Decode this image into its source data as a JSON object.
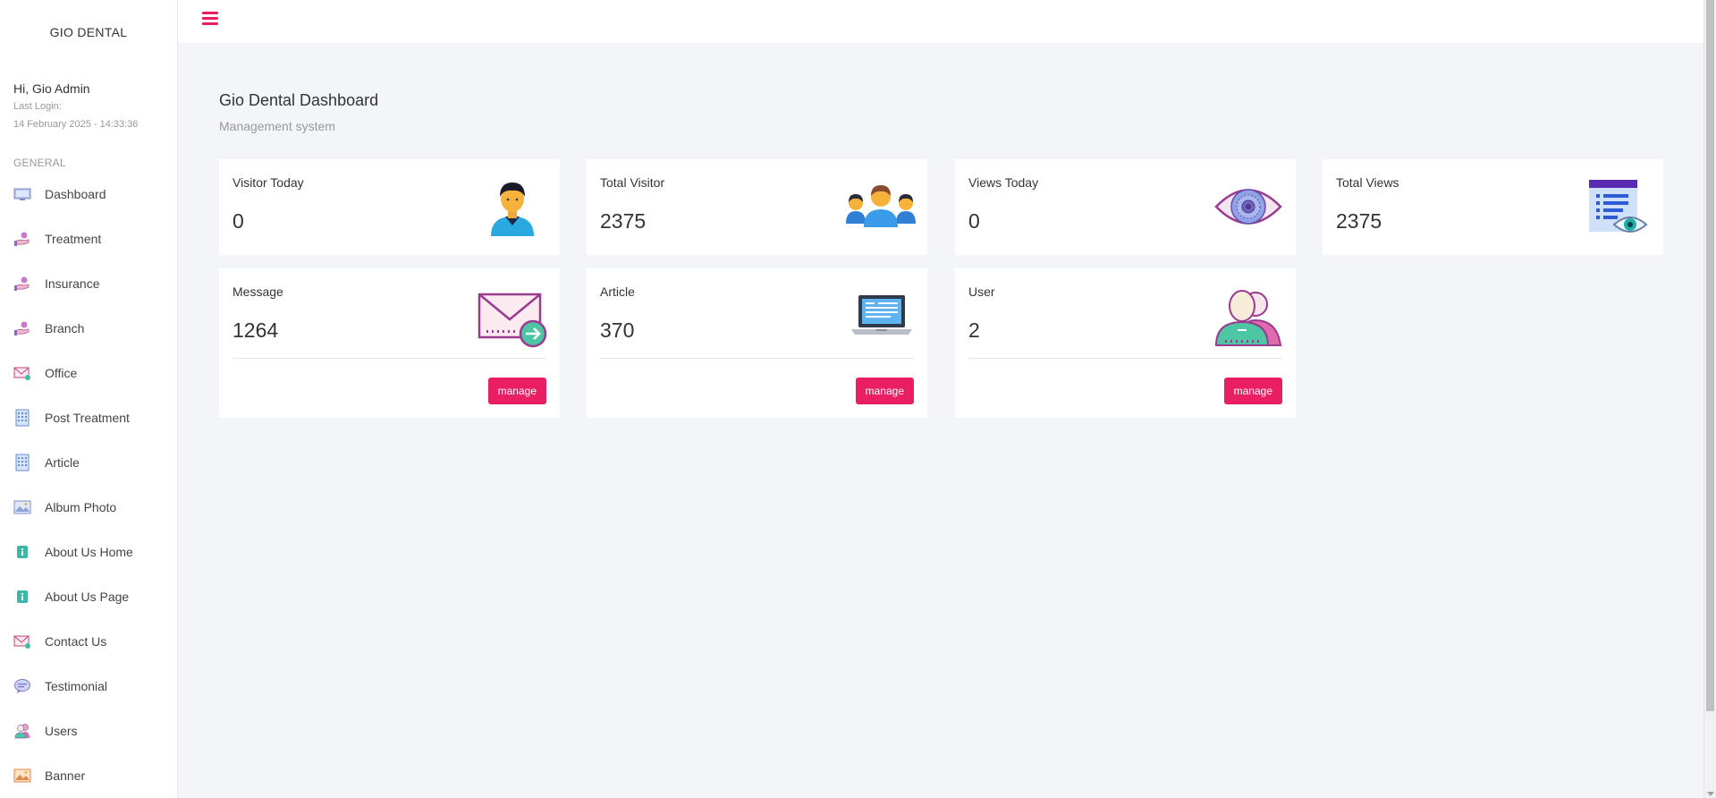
{
  "sidebar": {
    "brand": "GIO DENTAL",
    "greeting": "Hi, Gio Admin",
    "last_login_label": "Last Login:",
    "last_login_time": "14 February 2025 - 14:33:36",
    "section_title": "GENERAL",
    "items": [
      {
        "label": "Dashboard",
        "icon": "monitor-icon"
      },
      {
        "label": "Treatment",
        "icon": "hand-icon"
      },
      {
        "label": "Insurance",
        "icon": "hand-icon"
      },
      {
        "label": "Branch",
        "icon": "hand-icon"
      },
      {
        "label": "Office",
        "icon": "mail-icon"
      },
      {
        "label": "Post Treatment",
        "icon": "building-icon"
      },
      {
        "label": "Article",
        "icon": "building-icon"
      },
      {
        "label": "Album Photo",
        "icon": "image-icon"
      },
      {
        "label": "About Us Home",
        "icon": "info-icon"
      },
      {
        "label": "About Us Page",
        "icon": "info-icon"
      },
      {
        "label": "Contact Us",
        "icon": "mail-icon"
      },
      {
        "label": "Testimonial",
        "icon": "chat-icon"
      },
      {
        "label": "Users",
        "icon": "users-icon"
      },
      {
        "label": "Banner",
        "icon": "picture-icon"
      }
    ]
  },
  "topbar": {
    "menu_icon": "hamburger-icon"
  },
  "main": {
    "title": "Gio Dental Dashboard",
    "subtitle": "Management system",
    "stats": [
      {
        "label": "Visitor Today",
        "value": "0",
        "icon": "person-icon"
      },
      {
        "label": "Total Visitor",
        "value": "2375",
        "icon": "group-icon"
      },
      {
        "label": "Views Today",
        "value": "0",
        "icon": "eye-icon"
      },
      {
        "label": "Total Views",
        "value": "2375",
        "icon": "document-view-icon"
      },
      {
        "label": "Message",
        "value": "1264",
        "icon": "envelope-icon",
        "button": "manage"
      },
      {
        "label": "Article",
        "value": "370",
        "icon": "laptop-icon",
        "button": "manage"
      },
      {
        "label": "User",
        "value": "2",
        "icon": "users-icon",
        "button": "manage"
      }
    ]
  },
  "colors": {
    "accent": "#e91e63",
    "background": "#f4f5f9"
  }
}
